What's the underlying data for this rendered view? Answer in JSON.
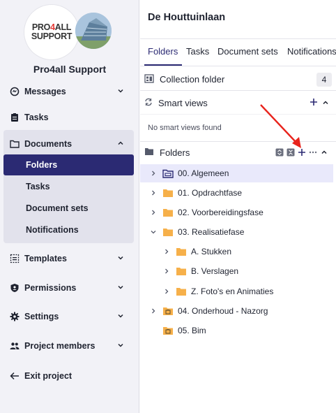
{
  "brand": {
    "logo_line1": "PRO",
    "logo_accent": "4",
    "logo_line1b": "ALL",
    "logo_line2": "SUPPORT",
    "name": "Pro4all Support"
  },
  "sidebar": {
    "items": [
      {
        "label": "Messages",
        "icon": "messages-icon"
      },
      {
        "label": "Tasks",
        "icon": "clipboard-icon"
      },
      {
        "label": "Documents",
        "icon": "folder-icon"
      },
      {
        "label": "Templates",
        "icon": "templates-icon"
      },
      {
        "label": "Permissions",
        "icon": "shield-icon"
      },
      {
        "label": "Settings",
        "icon": "gear-icon"
      },
      {
        "label": "Project members",
        "icon": "people-icon"
      },
      {
        "label": "Exit project",
        "icon": "arrow-left-icon"
      }
    ],
    "documents_sub": [
      "Folders",
      "Tasks",
      "Document sets",
      "Notifications"
    ]
  },
  "main": {
    "title": "De Houttuinlaan",
    "tabs": [
      "Folders",
      "Tasks",
      "Document sets",
      "Notifications"
    ],
    "collection_folder": {
      "label": "Collection folder",
      "count": "4"
    },
    "smart_views": {
      "label": "Smart views",
      "empty": "No smart views found"
    },
    "folders_label": "Folders",
    "tree": [
      {
        "label": "00. Algemeen"
      },
      {
        "label": "01. Opdrachtfase"
      },
      {
        "label": "02. Voorbereidingsfase"
      },
      {
        "label": "03. Realisatiefase"
      },
      {
        "label": "A. Stukken"
      },
      {
        "label": "B. Verslagen"
      },
      {
        "label": "Z. Foto's en Animaties"
      },
      {
        "label": "04. Onderhoud - Nazorg"
      },
      {
        "label": "05. Bim"
      }
    ]
  },
  "colors": {
    "accent": "#2b2a73",
    "folder": "#f6b04a",
    "annotation": "#e8231c",
    "selected_row": "#e9e9fb"
  }
}
